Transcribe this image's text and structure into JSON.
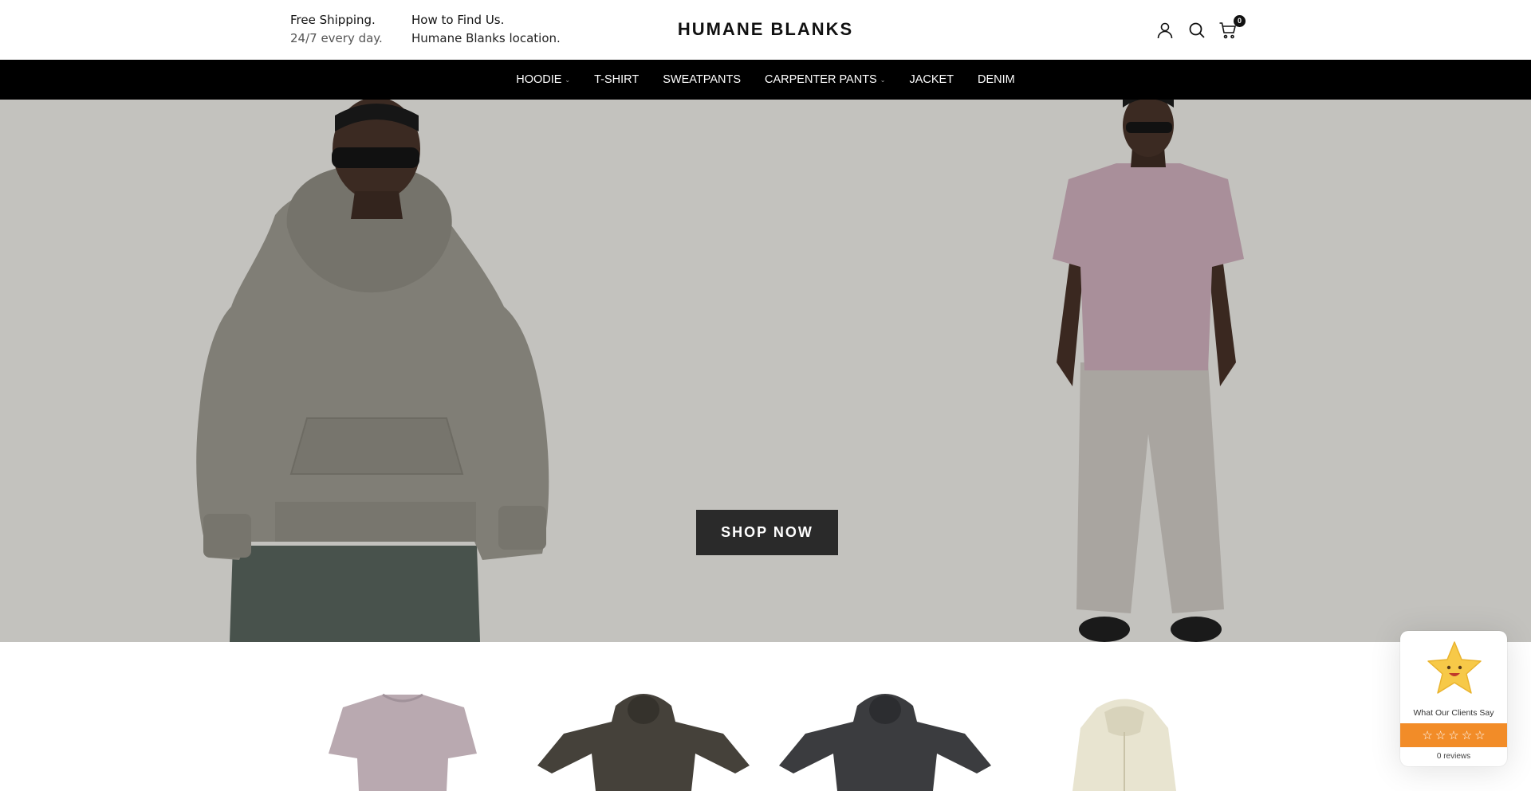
{
  "header": {
    "shipping_title": "Free Shipping.",
    "shipping_sub": "24/7 every day.",
    "location_title": "How to Find Us.",
    "location_sub": "Humane Blanks location.",
    "logo": "HUMANE BLANKS",
    "cart_count": "0",
    "icons": [
      "user-icon",
      "search-icon",
      "cart-icon"
    ]
  },
  "nav": {
    "items": [
      {
        "label": "HOODIE",
        "has_dropdown": true
      },
      {
        "label": "T-SHIRT",
        "has_dropdown": false
      },
      {
        "label": "SWEATPANTS",
        "has_dropdown": false
      },
      {
        "label": "CARPENTER PANTS",
        "has_dropdown": true
      },
      {
        "label": "JACKET",
        "has_dropdown": false
      },
      {
        "label": "DENIM",
        "has_dropdown": false
      }
    ]
  },
  "hero": {
    "cta_label": "SHOP NOW",
    "background_color": "#c3c2be"
  },
  "reviews_widget": {
    "title": "What Our Clients Say",
    "rating_stars": 0,
    "count_label": "0 reviews",
    "accent_color": "#f28c28"
  }
}
